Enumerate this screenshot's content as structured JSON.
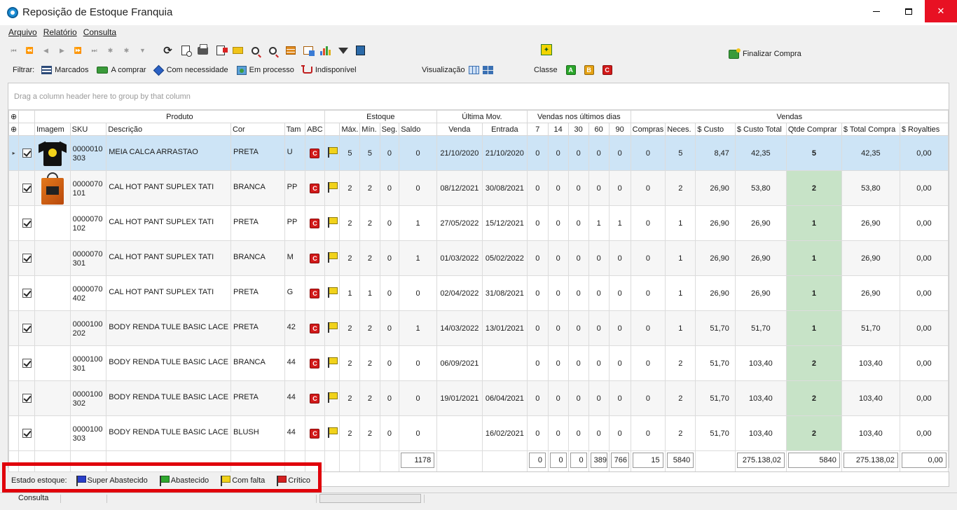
{
  "window": {
    "title": "Reposição de Estoque Franquia",
    "minimize": "—",
    "maximize": "☐",
    "close": "✕"
  },
  "menu": [
    "Arquivo",
    "Relatório",
    "Consulta"
  ],
  "toolbar": {
    "nav": [
      "⏮",
      "⏪",
      "◀",
      "▶",
      "⏩",
      "⏭",
      "✱",
      "✱",
      "▼"
    ],
    "icons": [
      "refresh-icon",
      "preview-icon",
      "print-icon",
      "export-icon",
      "email-icon",
      "zoom-in-icon",
      "zoom-out-icon",
      "grid-config-icon",
      "grid-save-icon",
      "chart-icon",
      "filter-icon",
      "exit-icon"
    ],
    "finalizar": "Finalizar Compra"
  },
  "filter": {
    "label": "Filtrar:",
    "items": [
      "Marcados",
      "A comprar",
      "Com necessidade",
      "Em processo",
      "Indisponível"
    ]
  },
  "visualizacao": "Visualização",
  "classe": {
    "label": "Classe",
    "badges": [
      {
        "text": "A",
        "color": "#2aa52a"
      },
      {
        "text": "B",
        "color": "#e5a113"
      },
      {
        "text": "C",
        "color": "#d21919"
      }
    ]
  },
  "grid": {
    "group_hint": "Drag a column header here to group by that column",
    "bands": {
      "produto": "Produto",
      "estoque": "Estoque",
      "ultima": "Última Mov.",
      "vendas_dias": "Vendas nos últimos dias",
      "vendas": "Vendas"
    },
    "columns": {
      "imagem": "Imagem",
      "sku": "SKU",
      "descricao": "Descrição",
      "cor": "Cor",
      "tam": "Tam",
      "abc": "ABC",
      "max": "Máx.",
      "min": "Mín.",
      "seg": "Seg.",
      "saldo": "Saldo",
      "venda": "Venda",
      "entrada": "Entrada",
      "d7": "7",
      "d14": "14",
      "d30": "30",
      "d60": "60",
      "d90": "90",
      "compras": "Compras",
      "neces": "Neces.",
      "custo": "$ Custo",
      "custo_total": "$ Custo Total",
      "qtde": "Qtde Comprar",
      "total_compra": "$ Total Compra",
      "royalties": "$ Royalties"
    },
    "rows": [
      {
        "sku": "0000010303",
        "desc": "MEIA CALCA ARRASTAO",
        "cor": "PRETA",
        "tam": "U",
        "abc": "C",
        "max": "5",
        "min": "5",
        "seg": "0",
        "saldo": "0",
        "venda": "21/10/2020",
        "entrada": "21/10/2020",
        "d7": "0",
        "d14": "0",
        "d30": "0",
        "d60": "0",
        "d90": "0",
        "compras": "0",
        "neces": "5",
        "custo": "8,47",
        "custo_total": "42,35",
        "qtde": "5",
        "total_compra": "42,35",
        "royalties": "0,00",
        "img": "shirt"
      },
      {
        "sku": "0000070101",
        "desc": "CAL HOT PANT SUPLEX TATI",
        "cor": "BRANCA",
        "tam": "PP",
        "abc": "C",
        "max": "2",
        "min": "2",
        "seg": "0",
        "saldo": "0",
        "venda": "08/12/2021",
        "entrada": "30/08/2021",
        "d7": "0",
        "d14": "0",
        "d30": "0",
        "d60": "0",
        "d90": "0",
        "compras": "0",
        "neces": "2",
        "custo": "26,90",
        "custo_total": "53,80",
        "qtde": "2",
        "total_compra": "53,80",
        "royalties": "0,00",
        "img": "bag"
      },
      {
        "sku": "0000070102",
        "desc": "CAL HOT PANT SUPLEX TATI",
        "cor": "PRETA",
        "tam": "PP",
        "abc": "C",
        "max": "2",
        "min": "2",
        "seg": "0",
        "saldo": "1",
        "venda": "27/05/2022",
        "entrada": "15/12/2021",
        "d7": "0",
        "d14": "0",
        "d30": "0",
        "d60": "1",
        "d90": "1",
        "compras": "0",
        "neces": "1",
        "custo": "26,90",
        "custo_total": "26,90",
        "qtde": "1",
        "total_compra": "26,90",
        "royalties": "0,00",
        "img": ""
      },
      {
        "sku": "0000070301",
        "desc": "CAL HOT PANT SUPLEX TATI",
        "cor": "BRANCA",
        "tam": "M",
        "abc": "C",
        "max": "2",
        "min": "2",
        "seg": "0",
        "saldo": "1",
        "venda": "01/03/2022",
        "entrada": "05/02/2022",
        "d7": "0",
        "d14": "0",
        "d30": "0",
        "d60": "0",
        "d90": "0",
        "compras": "0",
        "neces": "1",
        "custo": "26,90",
        "custo_total": "26,90",
        "qtde": "1",
        "total_compra": "26,90",
        "royalties": "0,00",
        "img": ""
      },
      {
        "sku": "0000070402",
        "desc": "CAL HOT PANT SUPLEX TATI",
        "cor": "PRETA",
        "tam": "G",
        "abc": "C",
        "max": "1",
        "min": "1",
        "seg": "0",
        "saldo": "0",
        "venda": "02/04/2022",
        "entrada": "31/08/2021",
        "d7": "0",
        "d14": "0",
        "d30": "0",
        "d60": "0",
        "d90": "0",
        "compras": "0",
        "neces": "1",
        "custo": "26,90",
        "custo_total": "26,90",
        "qtde": "1",
        "total_compra": "26,90",
        "royalties": "0,00",
        "img": ""
      },
      {
        "sku": "0000100202",
        "desc": "BODY RENDA TULE BASIC LACE",
        "cor": "PRETA",
        "tam": "42",
        "abc": "C",
        "max": "2",
        "min": "2",
        "seg": "0",
        "saldo": "1",
        "venda": "14/03/2022",
        "entrada": "13/01/2021",
        "d7": "0",
        "d14": "0",
        "d30": "0",
        "d60": "0",
        "d90": "0",
        "compras": "0",
        "neces": "1",
        "custo": "51,70",
        "custo_total": "51,70",
        "qtde": "1",
        "total_compra": "51,70",
        "royalties": "0,00",
        "img": ""
      },
      {
        "sku": "0000100301",
        "desc": "BODY RENDA TULE BASIC LACE",
        "cor": "BRANCA",
        "tam": "44",
        "abc": "C",
        "max": "2",
        "min": "2",
        "seg": "0",
        "saldo": "0",
        "venda": "06/09/2021",
        "entrada": "",
        "d7": "0",
        "d14": "0",
        "d30": "0",
        "d60": "0",
        "d90": "0",
        "compras": "0",
        "neces": "2",
        "custo": "51,70",
        "custo_total": "103,40",
        "qtde": "2",
        "total_compra": "103,40",
        "royalties": "0,00",
        "img": ""
      },
      {
        "sku": "0000100302",
        "desc": "BODY RENDA TULE BASIC LACE",
        "cor": "PRETA",
        "tam": "44",
        "abc": "C",
        "max": "2",
        "min": "2",
        "seg": "0",
        "saldo": "0",
        "venda": "19/01/2021",
        "entrada": "06/04/2021",
        "d7": "0",
        "d14": "0",
        "d30": "0",
        "d60": "0",
        "d90": "0",
        "compras": "0",
        "neces": "2",
        "custo": "51,70",
        "custo_total": "103,40",
        "qtde": "2",
        "total_compra": "103,40",
        "royalties": "0,00",
        "img": ""
      },
      {
        "sku": "0000100303",
        "desc": "BODY RENDA TULE BASIC LACE",
        "cor": "BLUSH",
        "tam": "44",
        "abc": "C",
        "max": "2",
        "min": "2",
        "seg": "0",
        "saldo": "0",
        "venda": "",
        "entrada": "16/02/2021",
        "d7": "0",
        "d14": "0",
        "d30": "0",
        "d60": "0",
        "d90": "0",
        "compras": "0",
        "neces": "2",
        "custo": "51,70",
        "custo_total": "103,40",
        "qtde": "2",
        "total_compra": "103,40",
        "royalties": "0,00",
        "img": ""
      }
    ],
    "totals": {
      "saldo": "1178",
      "d7": "0",
      "d14": "0",
      "d30": "0",
      "d60": "389",
      "d90": "766",
      "compras": "15",
      "neces": "5840",
      "custo_total": "275.138,02",
      "qtde": "5840",
      "total_compra": "275.138,02",
      "royalties": "0,00"
    }
  },
  "legend": {
    "label": "Estado estoque:",
    "items": [
      {
        "text": "Super Abastecido",
        "color": "#2a3fc9"
      },
      {
        "text": "Abastecido",
        "color": "#2fa82f"
      },
      {
        "text": "Com falta",
        "color": "#f1d21a"
      },
      {
        "text": "Crítico",
        "color": "#d42020"
      }
    ]
  },
  "status": {
    "text": "Consulta"
  }
}
